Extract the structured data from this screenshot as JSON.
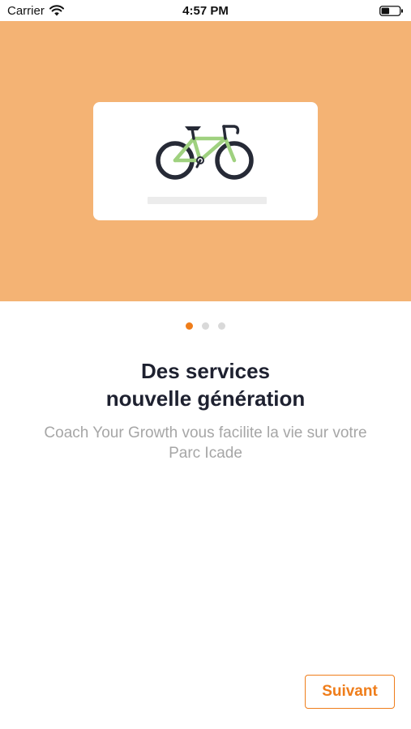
{
  "status_bar": {
    "carrier": "Carrier",
    "time": "4:57 PM",
    "icons": [
      "wifi-icon",
      "battery-icon"
    ]
  },
  "hero": {
    "background_color": "#f4b374",
    "illustration": "bicycle-icon",
    "bike_frame_color": "#9fd17f"
  },
  "pagination": {
    "total": 3,
    "current": 1,
    "active_color": "#ef7d1a"
  },
  "content": {
    "title_line1": "Des services",
    "title_line2": "nouvelle génération",
    "subtitle_line1": "Coach Your Growth vous facilite la vie sur votre",
    "subtitle_line2": "Parc Icade"
  },
  "footer": {
    "next_label": "Suivant",
    "accent_color": "#ef7d1a"
  }
}
